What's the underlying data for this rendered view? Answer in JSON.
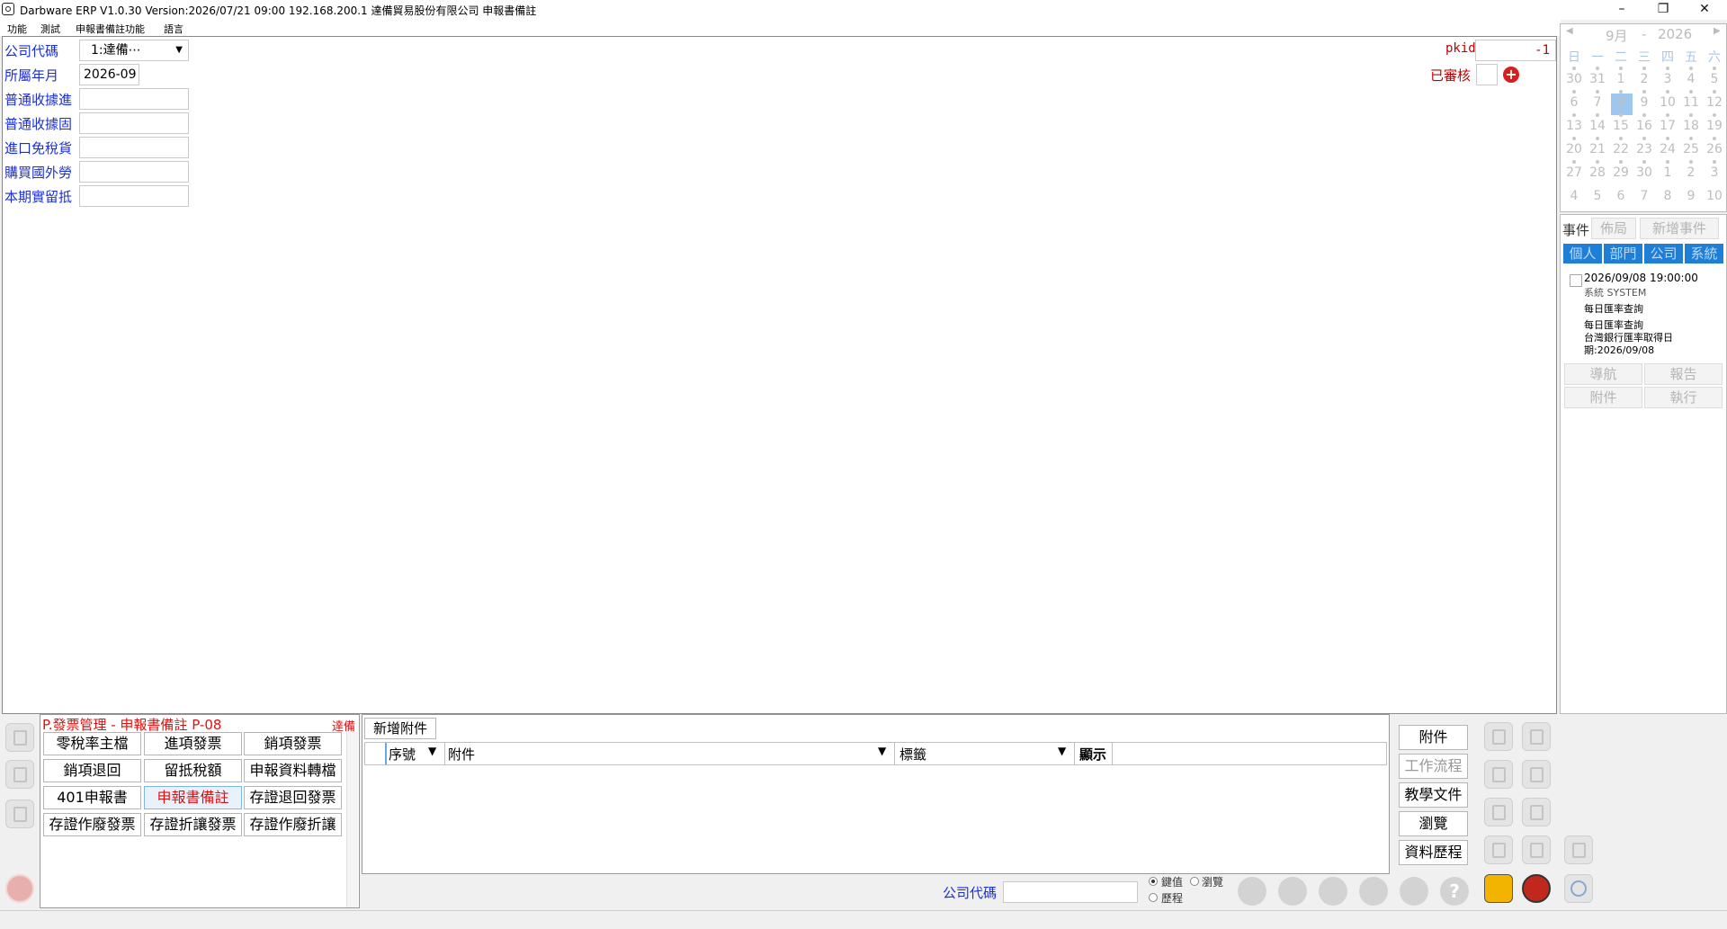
{
  "window": {
    "title": "Darbware ERP V1.0.30 Version:2026/07/21 09:00   192.168.200.1 達備貿易股份有限公司 申報書備註",
    "minimize": "–",
    "restore": "❐",
    "close": "✕"
  },
  "menu": [
    "功能",
    "測試",
    "申報書備註功能",
    "語言"
  ],
  "form": {
    "company_label": "公司代碼",
    "company_value": "1:達備⋯",
    "period_label": "所屬年月",
    "period_value": "2026-09",
    "field3_label": "普通收據進",
    "field4_label": "普通收據固",
    "field5_label": "進口免稅貨",
    "field6_label": "購買國外勞",
    "field7_label": "本期實留抵",
    "pkid_label": "pkid",
    "pkid_value": "-1",
    "reviewed_label": "已審核",
    "add_symbol": "+"
  },
  "calendar": {
    "prev": "◀",
    "next": "▶",
    "month": "9月",
    "sep": "-",
    "year": "2026",
    "weekdays": [
      "日",
      "一",
      "二",
      "三",
      "四",
      "五",
      "六"
    ],
    "weeks": [
      [
        "30",
        "31",
        "1",
        "2",
        "3",
        "4",
        "5"
      ],
      [
        "6",
        "7",
        "8",
        "9",
        "10",
        "11",
        "12"
      ],
      [
        "13",
        "14",
        "15",
        "16",
        "17",
        "18",
        "19"
      ],
      [
        "20",
        "21",
        "22",
        "23",
        "24",
        "25",
        "26"
      ],
      [
        "27",
        "28",
        "29",
        "30",
        "1",
        "2",
        "3"
      ],
      [
        "4",
        "5",
        "6",
        "7",
        "8",
        "9",
        "10"
      ]
    ]
  },
  "events": {
    "label": "事件",
    "layout_btn": "佈局",
    "new_btn": "新增事件",
    "filters": [
      "個人",
      "部門",
      "公司",
      "系統"
    ],
    "item": {
      "datetime": "2026/09/08 19:00:00",
      "source": "系統  SYSTEM",
      "title": "每日匯率查詢",
      "desc1": "每日匯率查詢",
      "desc2": "台灣銀行匯率取得日",
      "desc3": "期:2026/09/08"
    },
    "actions": [
      "導航",
      "報告",
      "附件",
      "執行"
    ]
  },
  "menu_panel": {
    "title": "P.發票管理 - 申報書備註  P-08",
    "user": "達備",
    "buttons": [
      "零稅率主檔",
      "進項發票",
      "銷項發票",
      "銷項退回",
      "留抵稅額",
      "申報資料轉檔",
      "401申報書",
      "申報書備註",
      "存證退回發票",
      "存證作廢發票",
      "存證折讓發票",
      "存證作廢折讓"
    ]
  },
  "attachments": {
    "add_btn": "新增附件",
    "columns": [
      "序號",
      "附件",
      "標籤",
      "顯示"
    ]
  },
  "side_buttons": [
    "附件",
    "工作流程",
    "教學文件",
    "瀏覽",
    "資料歷程"
  ],
  "bottom": {
    "company_label": "公司代碼",
    "radio_key": "鍵值",
    "radio_browse": "瀏覽",
    "radio_history": "歷程",
    "help": "?"
  },
  "colors": {
    "label_blue": "#1b2fd6",
    "accent_red": "#c00000",
    "calendar_selected": "#9ec7f0",
    "event_blue": "#1f7fd6"
  }
}
